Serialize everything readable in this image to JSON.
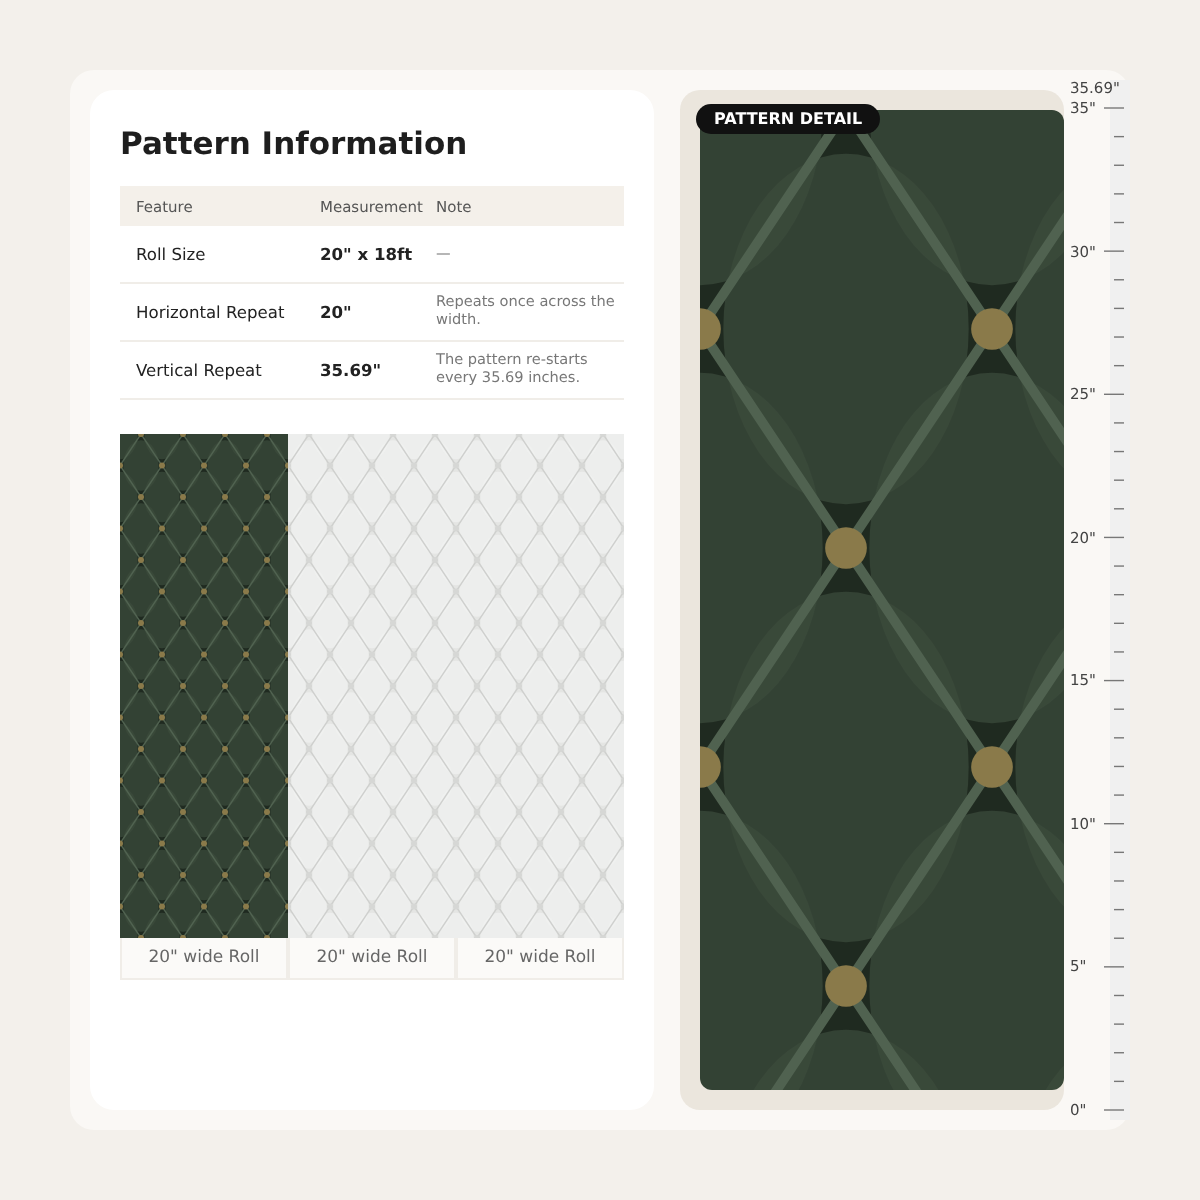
{
  "info_card": {
    "title": "Pattern Information",
    "table": {
      "columns": [
        "Feature",
        "Measurement",
        "Note"
      ],
      "rows": [
        {
          "feature": "Roll Size",
          "measurement": "20\" x 18ft",
          "note": "—"
        },
        {
          "feature": "Horizontal Repeat",
          "measurement": "20\"",
          "note": "Repeats once across the width."
        },
        {
          "feature": "Vertical Repeat",
          "measurement": "35.69\"",
          "note": "The pattern re-starts every 35.69 inches."
        }
      ]
    },
    "rolls": [
      {
        "kind": "colored",
        "caption": "20\" wide Roll"
      },
      {
        "kind": "faded",
        "caption": "20\" wide Roll"
      },
      {
        "kind": "faded",
        "caption": "20\" wide Roll"
      }
    ]
  },
  "detail": {
    "badge": "PATTERN DETAIL"
  },
  "ruler": {
    "top_label": "35.69\"",
    "labels": [
      "35\"",
      "30\"",
      "25\"",
      "20\"",
      "15\"",
      "10\"",
      "5\"",
      "0\""
    ]
  }
}
